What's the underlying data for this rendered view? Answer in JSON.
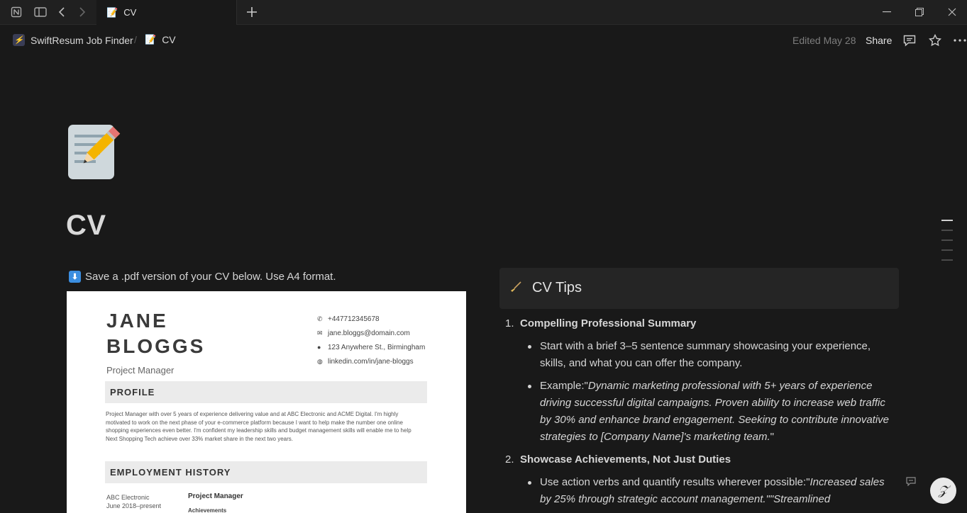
{
  "titlebar": {
    "tab_title": "CV",
    "tab_emoji": "📝"
  },
  "breadcrumb": {
    "workspace": "SwiftResum Job Finder",
    "separator": "/",
    "page": "CV"
  },
  "header": {
    "edited": "Edited May 28",
    "share": "Share"
  },
  "page": {
    "title": "CV",
    "save_note": "Save a .pdf version of your CV below. Use A4 format."
  },
  "cv_document": {
    "name_line1": "JANE",
    "name_line2": "BLOGGS",
    "role": "Project Manager",
    "phone": "+447712345678",
    "email": "jane.bloggs@domain.com",
    "address": "123 Anywhere St., Birmingham",
    "linkedin": "linkedin.com/in/jane-bloggs",
    "profile_heading": "PROFILE",
    "profile_text": "Project Manager with over 5 years of experience delivering value and at ABC Electronic and ACME Digital. I'm highly motivated to work on the next phase of your e-commerce platform because I want to help make the number one online shopping experiences even better. I'm confident my leadership skills and budget management skills will enable me to help Next Shopping Tech achieve over 33% market share in the next two years.",
    "employment_heading": "EMPLOYMENT HISTORY",
    "employer": "ABC Electronic",
    "dates": "June 2018–present",
    "job_title": "Project Manager",
    "achievements": "Achievements"
  },
  "tips": {
    "heading": "CV Tips",
    "items": [
      {
        "num": "1.",
        "title": "Compelling Professional Summary",
        "b1": "Start with a brief 3–5 sentence summary showcasing your experience, skills, and what you can offer the company.",
        "b2_prefix": "Example:\"",
        "b2_italic": "Dynamic marketing professional with 5+ years of experience driving successful digital campaigns. Proven ability to increase web traffic by 30% and enhance brand engagement. Seeking to contribute innovative strategies to [Company Name]'s marketing team.",
        "b2_suffix": "\""
      },
      {
        "num": "2.",
        "title": "Showcase Achievements, Not Just Duties",
        "b1_prefix": "Use action verbs and quantify results wherever possible:\"",
        "b1_italic": "Increased sales by 25% through strategic account management.\"\"Streamlined"
      }
    ]
  }
}
